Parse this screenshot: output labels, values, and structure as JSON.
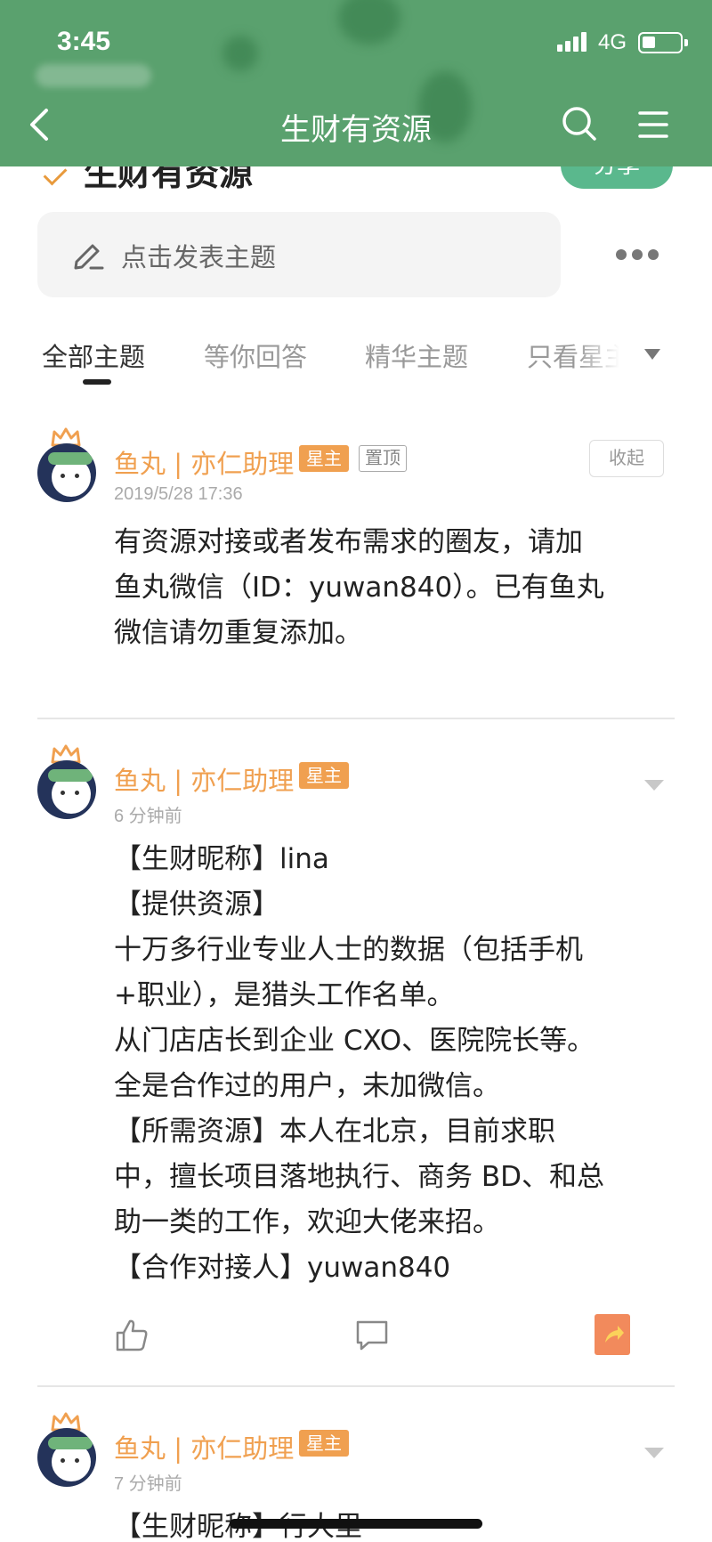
{
  "status_bar": {
    "time": "3:45",
    "network": "4G"
  },
  "header": {
    "title": "生财有资源"
  },
  "peek": {
    "group_title": "生财有资源",
    "share_label": "分享"
  },
  "compose": {
    "placeholder": "点击发表主题"
  },
  "tabs": [
    {
      "label": "全部主题",
      "active": true
    },
    {
      "label": "等你回答",
      "active": false
    },
    {
      "label": "精华主题",
      "active": false
    },
    {
      "label": "只看星主",
      "active": false
    }
  ],
  "posts": [
    {
      "author": "鱼丸 | 亦仁助理",
      "role_badge": "星主",
      "pin_badge": "置顶",
      "collapse_label": "收起",
      "timestamp": "2019/5/28 17:36",
      "lines": [
        "有资源对接或者发布需求的圈友，请加",
        "鱼丸微信（ID：yuwan840）。已有鱼丸",
        "微信请勿重复添加。"
      ]
    },
    {
      "author": "鱼丸 | 亦仁助理",
      "role_badge": "星主",
      "timestamp": "6 分钟前",
      "lines": [
        "【生财昵称】lina",
        "【提供资源】",
        "十万多行业专业人士的数据（包括手机",
        "+职业），是猎头工作名单。",
        "从门店店长到企业 CXO、医院院长等。",
        "全是合作过的用户，未加微信。",
        "【所需资源】本人在北京，目前求职",
        "中，擅长项目落地执行、商务 BD、和总",
        "助一类的工作，欢迎大佬来招。",
        "【合作对接人】yuwan840"
      ]
    },
    {
      "author": "鱼丸 | 亦仁助理",
      "role_badge": "星主",
      "timestamp": "7 分钟前",
      "lines": [
        "【生财昵称】行大里"
      ]
    }
  ],
  "colors": {
    "header_green": "#5aa16e",
    "accent_orange": "#f0a050",
    "share_green": "#5ab88d"
  }
}
